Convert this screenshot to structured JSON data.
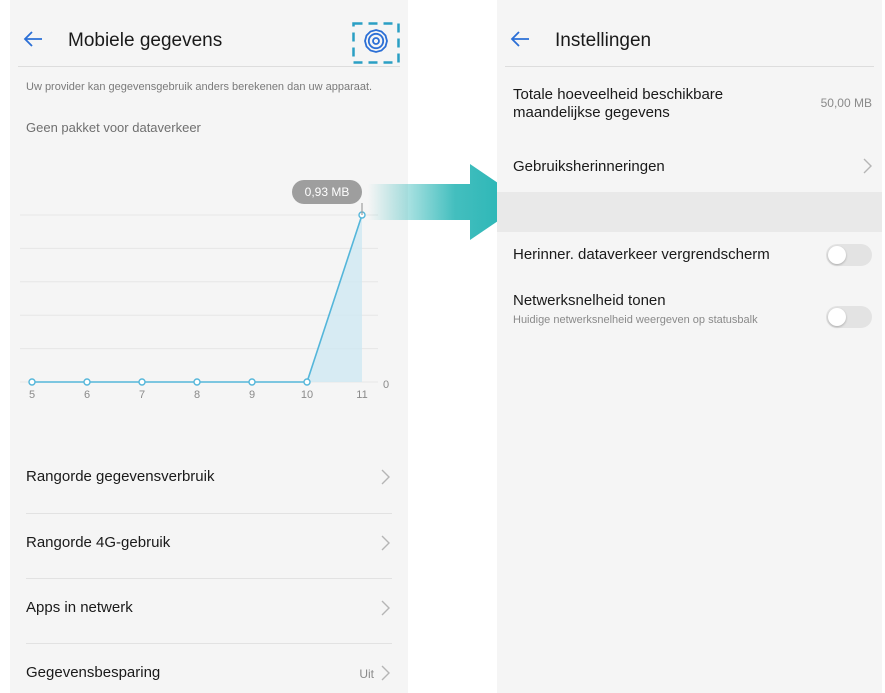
{
  "colors": {
    "accent": "#2b6fd6",
    "chart_line": "#54b6da",
    "chart_fill": "#cfe8f3",
    "callout": "#9e9e9e",
    "arrow": "#22b3b3",
    "highlight_dash": "#2a9fc4"
  },
  "left_screen": {
    "title": "Mobiele gegevens",
    "back_icon": "arrow-left-icon",
    "settings_icon": "gear-icon",
    "note": "Uw provider kan gegevensgebruik anders berekenen dan uw apparaat.",
    "plan_status": "Geen pakket voor dataverkeer",
    "menu": [
      {
        "label": "Rangorde gegevensverbruik",
        "value": ""
      },
      {
        "label": "Rangorde 4G-gebruik",
        "value": ""
      },
      {
        "label": "Apps in netwerk",
        "value": ""
      },
      {
        "label": "Gegevensbesparing",
        "value": "Uit"
      }
    ]
  },
  "chart_data": {
    "type": "area",
    "x": [
      "5",
      "6",
      "7",
      "8",
      "9",
      "10",
      "11"
    ],
    "values": [
      0,
      0,
      0,
      0,
      0,
      0,
      0.93
    ],
    "unit": "MB",
    "callout": "0,93 MB",
    "y_tick_label": "0",
    "grid": true
  },
  "right_screen": {
    "title": "Instellingen",
    "back_icon": "arrow-left-icon",
    "monthly_label": "Totale hoeveelheid beschikbare maandelijkse gegevens",
    "monthly_value": "50,00 MB",
    "reminders_label": "Gebruiksherinneringen",
    "lockscreen_label": "Herinner. dataverkeer vergrendscherm",
    "lockscreen_on": false,
    "speed_label": "Netwerksnelheid tonen",
    "speed_sub": "Huidige netwerksnelheid weergeven op statusbalk",
    "speed_on": false
  }
}
